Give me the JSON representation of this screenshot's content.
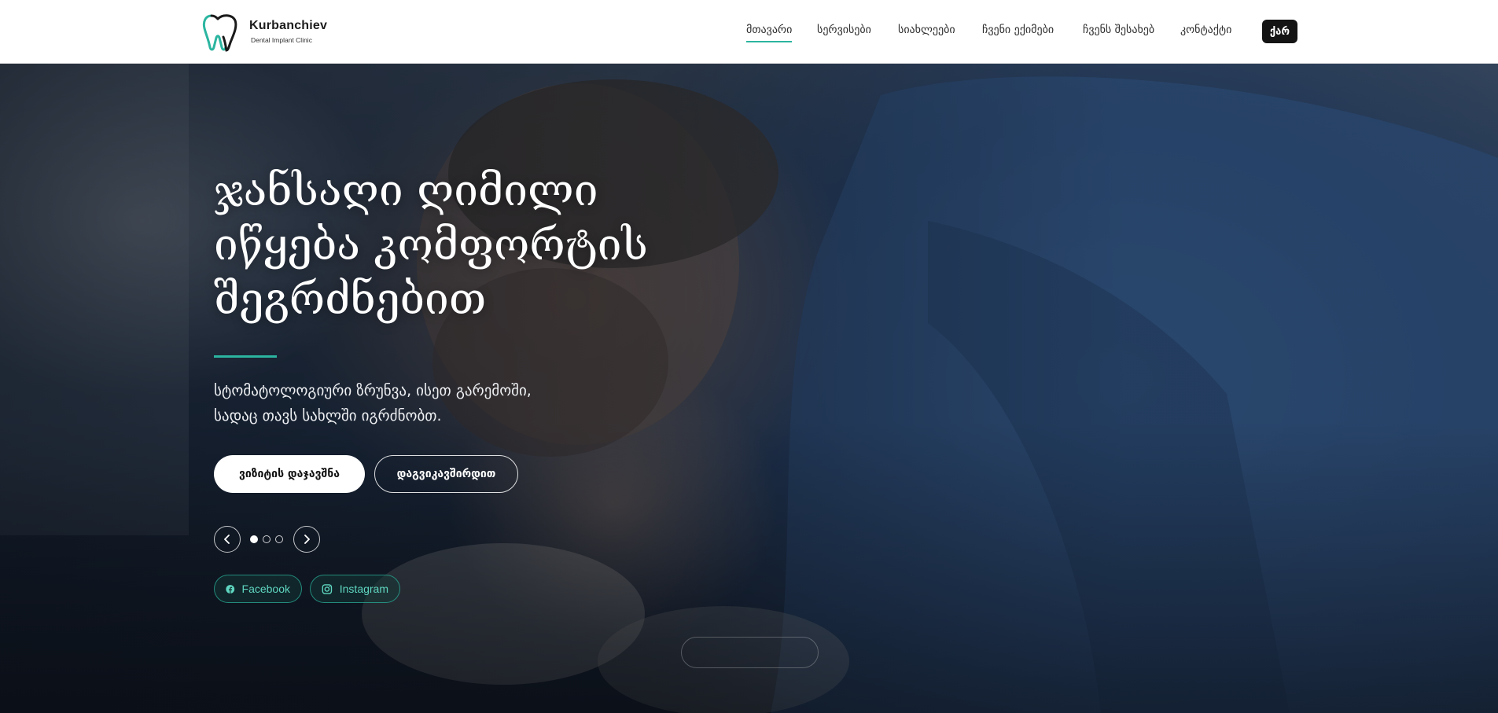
{
  "brand": {
    "name": "Kurbanchiev",
    "tagline": "Dental Implant Clinic",
    "accent_color": "#2bb5a0"
  },
  "nav": {
    "items": [
      {
        "label": "მთავარი",
        "active": true
      },
      {
        "label": "სერვისები",
        "active": false
      },
      {
        "label": "სიახლეები",
        "active": false
      },
      {
        "label": "ჩვენი ექიმები",
        "active": false
      },
      {
        "label": "ჩვენს შესახებ",
        "active": false
      },
      {
        "label": "კონტაქტი",
        "active": false
      }
    ],
    "language": "ქარ"
  },
  "hero": {
    "title_lines": [
      "ჯანსაღი ღიმილი",
      "იწყება კომფორტის",
      "შეგრძნებით"
    ],
    "subtitle_lines": [
      "სტომატოლოგიური ზრუნვა, ისეთ გარემოში,",
      "სადაც თავს სახლში იგრძნობთ."
    ],
    "primary_button": "ვიზიტის დაჯავშნა",
    "secondary_button": "დაგვიკავშირდით",
    "slider": {
      "total": 3,
      "active": 1
    }
  },
  "social": {
    "facebook": "Facebook",
    "instagram": "Instagram"
  }
}
